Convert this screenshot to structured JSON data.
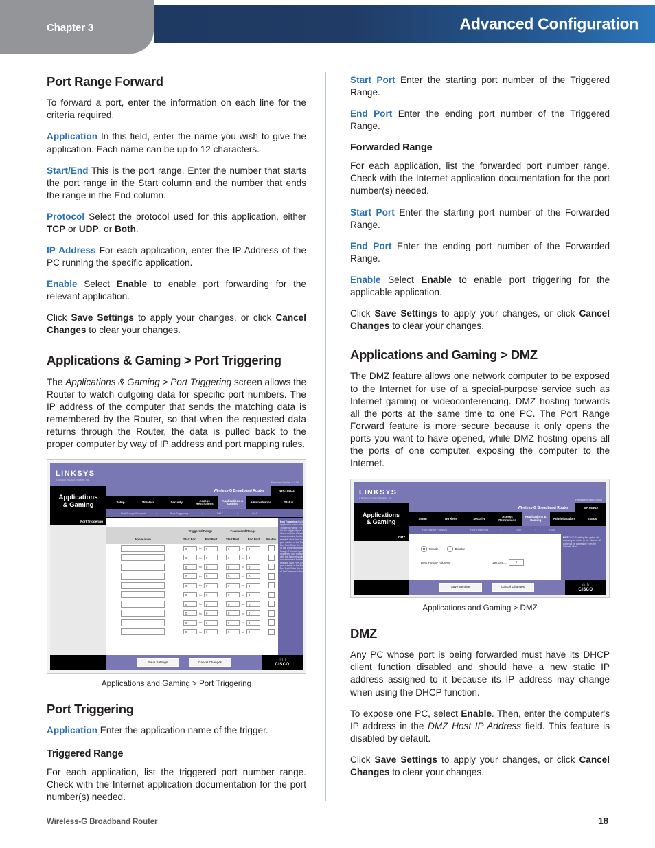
{
  "header": {
    "chapter": "Chapter 3",
    "title": "Advanced Configuration",
    "accent_blue": "#2a72b8",
    "bar_dark": "#1e3a63",
    "bar_light": "#2d76bb",
    "chapter_bg": "#939598"
  },
  "left_column": {
    "h_port_range_forward": "Port Range Forward",
    "p_intro": "To forward a port, enter the information on each line for the criteria required.",
    "application_term": "Application",
    "application_text": "In this field, enter the name you wish to give the application. Each name can be up to 12 characters.",
    "startend_term": "Start/End",
    "startend_text": "This is the port range. Enter the number that starts the port range in the Start column and the number that ends the range in the End column.",
    "protocol_term": "Protocol",
    "protocol_text_a": "Select the protocol used for this application, either ",
    "protocol_tcp": "TCP",
    "protocol_or": " or ",
    "protocol_udp": "UDP",
    "protocol_comma": ", or ",
    "protocol_both": "Both",
    "protocol_period": ".",
    "ipaddress_term": "IP Address",
    "ipaddress_text": "For each application, enter the IP Address of the PC running the specific application.",
    "enable_term": "Enable",
    "enable_text_a": "Select ",
    "enable_bold": "Enable",
    "enable_text_b": " to enable port forwarding for the relevant application.",
    "click_a": "Click ",
    "click_save": "Save Settings",
    "click_b": " to apply your changes, or click ",
    "click_cancel": "Cancel Changes",
    "click_c": " to clear your changes.",
    "h_app_gaming_port_triggering": "Applications & Gaming > Port Triggering",
    "p_pt_intro_a": "The ",
    "p_pt_intro_italic": "Applications & Gaming > Port Triggering",
    "p_pt_intro_b": " screen allows the Router to watch outgoing data for specific port numbers. The IP address of the computer that sends the matching data is remembered by the Router, so that when the requested data returns through the Router, the data is pulled back to the proper computer by way of IP address and port mapping rules.",
    "caption_pt": "Applications and Gaming > Port Triggering",
    "h_port_triggering": "Port Triggering",
    "pt_application_term": "Application",
    "pt_application_text": "Enter the application name of the trigger.",
    "h_triggered_range": "Triggered Range",
    "p_triggered_range": "For each application, list the triggered port number range. Check with the Internet application documentation for the port number(s) needed."
  },
  "right_column": {
    "start_port_term": "Start Port",
    "start_port_text": "Enter the starting port number of the Triggered Range.",
    "end_port_term": "End Port",
    "end_port_text": "Enter the ending port number of the Triggered Range.",
    "h_forwarded_range": "Forwarded Range",
    "p_forwarded_range": "For each application, list the forwarded port number range. Check with the Internet application documentation for the port number(s) needed.",
    "start_port2_term": "Start Port",
    "start_port2_text": "Enter the starting port number of the Forwarded Range.",
    "end_port2_term": "End Port",
    "end_port2_text": "Enter the ending port number of the Forwarded Range.",
    "enable_term": "Enable",
    "enable_text_a": "Select ",
    "enable_bold": "Enable",
    "enable_text_b": " to enable port triggering for the applicable application.",
    "click_a": "Click ",
    "click_save": "Save Settings",
    "click_b": " to apply your changes, or click ",
    "click_cancel": "Cancel Changes",
    "click_c": " to clear your changes.",
    "h_app_gaming_dmz": "Applications and Gaming > DMZ",
    "p_dmz_intro": "The DMZ feature allows one network computer to be exposed to the Internet for use of a special-purpose service such as Internet gaming or videoconferencing. DMZ hosting forwards all the ports at the same time to one PC. The Port Range Forward feature is more secure because it only opens the ports you want to have opened, while DMZ hosting opens all the ports of one computer, exposing the computer to the Internet.",
    "caption_dmz": "Applications and Gaming > DMZ",
    "h_dmz": "DMZ",
    "p_dmz_1": "Any PC whose port is being forwarded must have its DHCP client function disabled and should have a new static IP address assigned to it because its IP address may change when using the DHCP function.",
    "p_dmz_2_a": "To expose one PC, select ",
    "p_dmz_2_bold": "Enable",
    "p_dmz_2_b": ". Then, enter the computer's IP address in the ",
    "p_dmz_2_italic": "DMZ Host IP Address",
    "p_dmz_2_c": " field. This feature is disabled by default."
  },
  "router_ui": {
    "brand": "LINKSYS",
    "brand_sub": "A Division of Cisco Systems, Inc.",
    "firmware": "Firmware Version: 1.0.00",
    "product": "Wireless-G Broadband Router",
    "model": "WRT54G2",
    "section_title_line1": "Applications",
    "section_title_line2": "& Gaming",
    "tabs": [
      "Setup",
      "Wireless",
      "Security",
      "Access Restrictions",
      "Applications & Gaming",
      "Administration",
      "Status"
    ],
    "active_tab": "Applications & Gaming",
    "subtabs": [
      "Port Range Forward",
      "Port Triggering",
      "DMZ",
      "QoS"
    ],
    "save_button": "Save Settings",
    "cancel_button": "Cancel Changes",
    "cisco_bridge": "ılıılı",
    "cisco_name": "CISCO",
    "port_triggering": {
      "left_label": "Port Triggering",
      "group_triggered": "Triggered Range",
      "group_forwarded": "Forwarded Range",
      "col_application": "Application",
      "col_start_port": "Start Port",
      "col_end_port": "End Port",
      "col_start_port2": "Start Port",
      "col_end_port2": "End Port",
      "col_enable": "Enable",
      "row_count": 10,
      "default_value": "0",
      "to_label": "to",
      "help_title": "Port Triggering",
      "help_text": "Application: Enter the application name of the trigger. Triggered Range: For each application, list the triggered port number range. Check with the Internet application documentation for the port number(s) needed. Start Port: Enter the starting port number of the Triggered Range. End Port: Enter the ending port number of the Triggered Range. Forwarded Range: For each application, list the forwarded port number range. Check with the Internet application documentation for the port number(s) needed. Start Port: Enter the starting port number of the Forwarded Range. End Port: Enter the ending port number of the Forwarded Range."
    },
    "dmz": {
      "left_label": "DMZ",
      "enable_label": "Enable",
      "disable_label": "Disable",
      "host_ip_label": "DMZ Host IP Address",
      "host_ip_prefix": "192.168.1.",
      "host_ip_value": "0",
      "help_title": "DMZ",
      "help_text": "DMZ: Enabling this option will expose your router to the Internet. All ports will be accessible from the Internet. More..."
    }
  },
  "footer": {
    "document": "Wireless-G Broadband Router",
    "page": "18"
  }
}
